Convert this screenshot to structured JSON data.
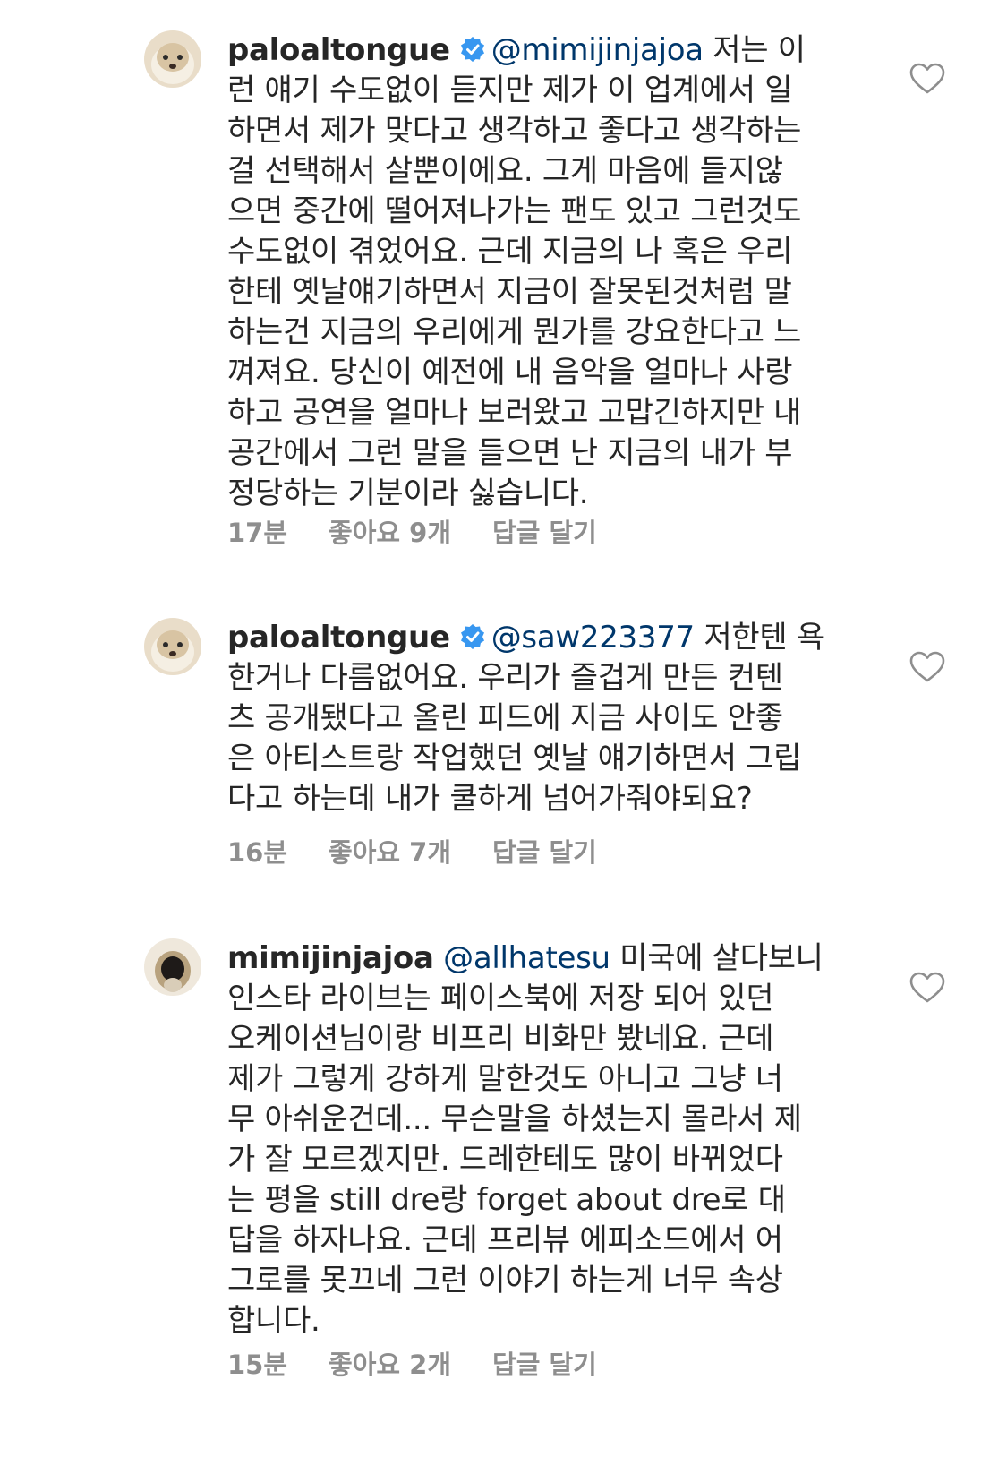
{
  "comments": [
    {
      "username": "paloaltongue",
      "verified": true,
      "mention": "@mimijinjajoa",
      "lines": [
        "저는 이",
        "런 얘기 수도없이 듣지만 제가 이 업계에서 일",
        "하면서 제가 맞다고 생각하고 좋다고 생각하는",
        "걸 선택해서 살뿐이에요. 그게 마음에 들지않",
        "으면 중간에 떨어져나가는 팬도 있고 그런것도",
        "수도없이 겪었어요. 근데 지금의 나 혹은 우리",
        "한테 옛날얘기하면서 지금이 잘못된것처럼 말",
        "하는건 지금의 우리에게 뭔가를 강요한다고 느",
        "껴져요. 당신이 예전에 내 음악을 얼마나 사랑",
        "하고 공연을 얼마나 보러왔고 고맙긴하지만 내",
        "공간에서 그런 말을 들으면 난 지금의 내가 부",
        "정당하는 기분이라 싫습니다."
      ],
      "time": "17분",
      "likes": "좋아요 9개",
      "reply": "답글 달기"
    },
    {
      "username": "paloaltongue",
      "verified": true,
      "mention": "@saw223377",
      "lines": [
        "저한텐 욕",
        "한거나 다름없어요. 우리가 즐겁게 만든 컨텐",
        "츠 공개됐다고 올린 피드에 지금 사이도 안좋",
        "은 아티스트랑 작업했던 옛날 얘기하면서 그립",
        "다고 하는데 내가 쿨하게 넘어가줘야되요?"
      ],
      "time": "16분",
      "likes": "좋아요 7개",
      "reply": "답글 달기"
    },
    {
      "username": "mimijinjajoa",
      "verified": false,
      "mention": "@allhatesu",
      "lines": [
        "미국에 살다보니",
        "인스타 라이브는 페이스북에 저장 되어 있던",
        "오케이션님이랑 비프리 비화만 봤네요. 근데",
        "제가 그렇게 강하게 말한것도 아니고 그냥 너",
        "무 아쉬운건데... 무슨말을 하셨는지 몰라서 제",
        "가 잘 모르겠지만. 드레한테도 많이 바뀌었다",
        "는 평을 still dre랑 forget about dre로 대",
        "답을 하자나요. 근데 프리뷰 에피소드에서 어",
        "그로를 못끄네 그런 이야기 하는게 너무 속상",
        "합니다."
      ],
      "time": "15분",
      "likes": "좋아요 2개",
      "reply": "답글 달기"
    }
  ],
  "icons": {
    "verified": "verified-badge-icon",
    "like": "heart-outline-icon"
  },
  "colors": {
    "text": "#262626",
    "meta": "#8e8e8e",
    "mention": "#00376b",
    "verified": "#3897f0",
    "heart": "#8e8e8e"
  }
}
